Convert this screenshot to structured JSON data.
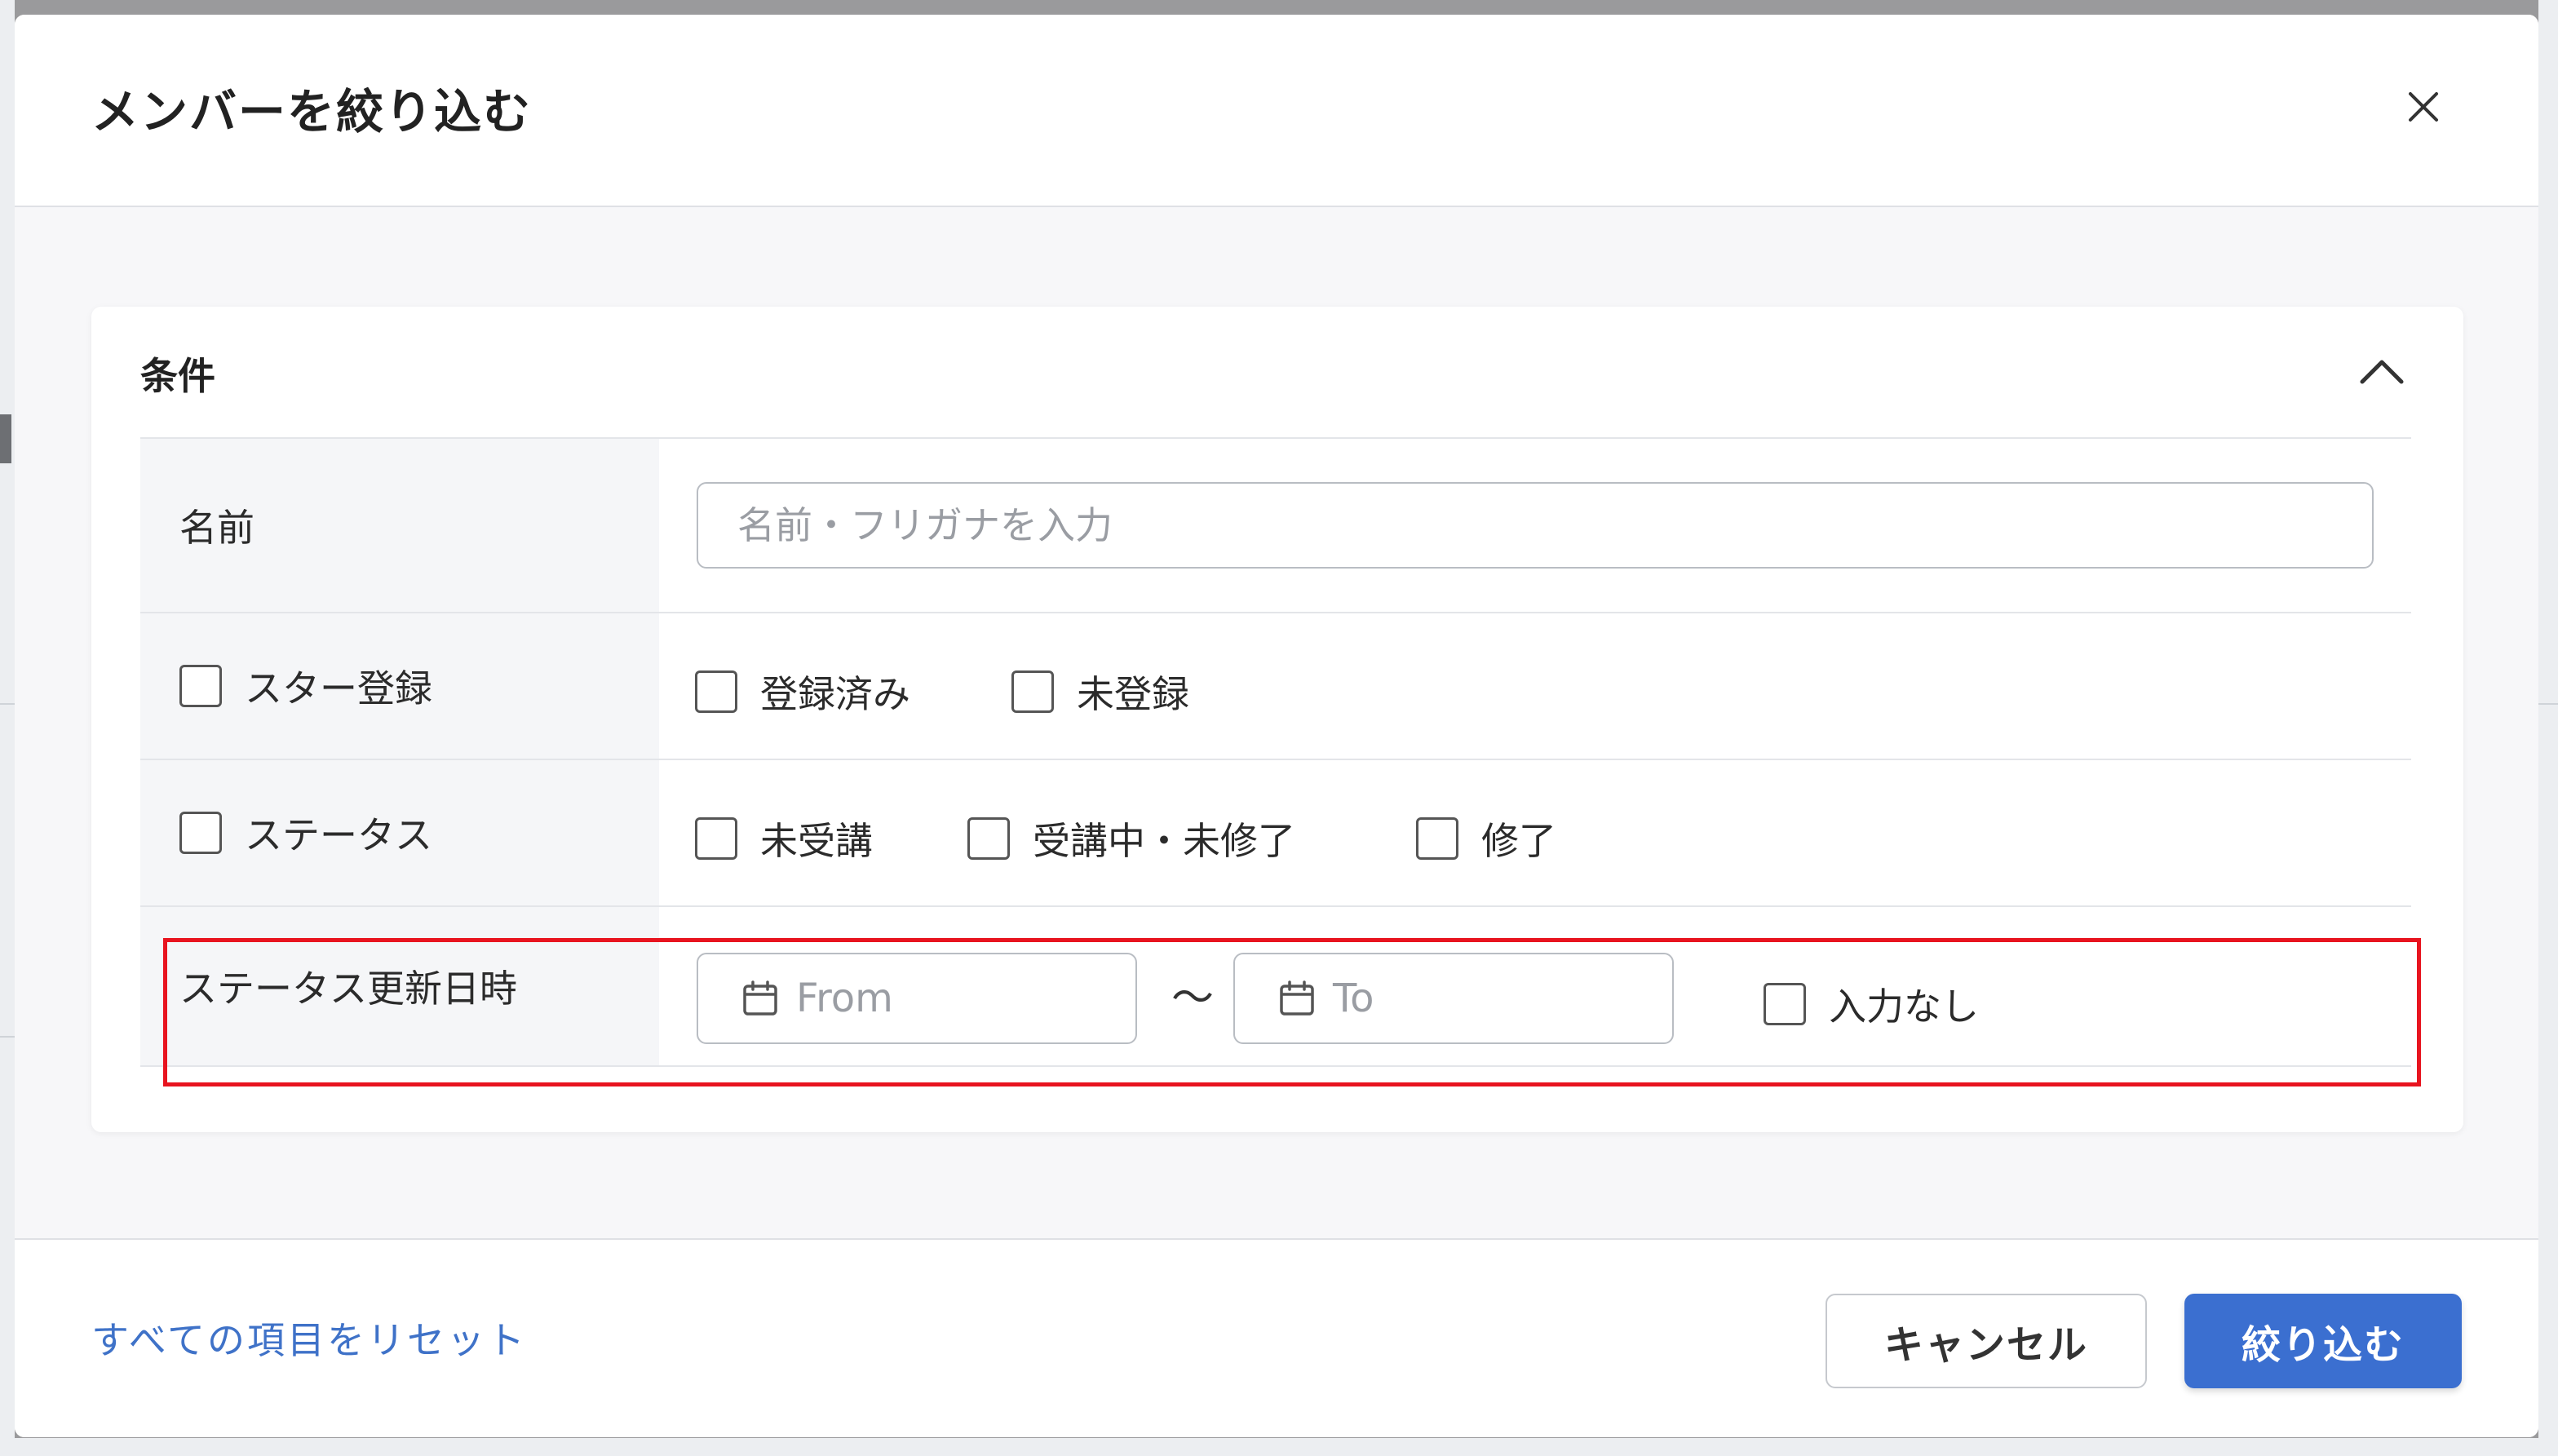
{
  "dialog": {
    "title": "メンバーを絞り込む",
    "close_icon": "close-icon"
  },
  "conditions": {
    "title": "条件",
    "collapse_icon": "chevron-up-icon",
    "name_row": {
      "label": "名前",
      "placeholder": "名前・フリガナを入力",
      "value": ""
    },
    "star_row": {
      "label": "スター登録",
      "checked": false,
      "options": [
        {
          "label": "登録済み",
          "checked": false
        },
        {
          "label": "未登録",
          "checked": false
        }
      ]
    },
    "status_row": {
      "label": "ステータス",
      "checked": false,
      "options": [
        {
          "label": "未受講",
          "checked": false
        },
        {
          "label": "受講中・未修了",
          "checked": false
        },
        {
          "label": "修了",
          "checked": false
        }
      ]
    },
    "status_date_row": {
      "label": "ステータス更新日時",
      "from_placeholder": "From",
      "separator": "〜",
      "to_placeholder": "To",
      "calendar_icon": "calendar-icon",
      "no_input": {
        "label": "入力なし",
        "checked": false
      }
    }
  },
  "highlight_color": "#e8141f",
  "footer": {
    "reset_label": "すべての項目をリセット",
    "cancel_label": "キャンセル",
    "apply_label": "絞り込む"
  },
  "colors": {
    "accent": "#3b6fd0",
    "link": "#3f72c8"
  }
}
